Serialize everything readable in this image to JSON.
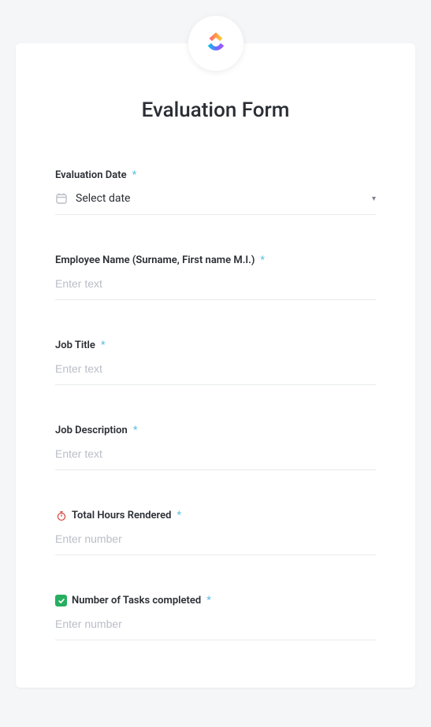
{
  "title": "Evaluation Form",
  "fields": {
    "evaluation_date": {
      "label": "Evaluation Date",
      "placeholder": "Select date"
    },
    "employee_name": {
      "label": "Employee Name (Surname, First name M.I.)",
      "placeholder": "Enter text"
    },
    "job_title": {
      "label": "Job Title",
      "placeholder": "Enter text"
    },
    "job_description": {
      "label": "Job Description",
      "placeholder": "Enter text"
    },
    "total_hours": {
      "label": "Total Hours Rendered",
      "placeholder": "Enter number"
    },
    "tasks_completed": {
      "label": "Number of Tasks completed",
      "placeholder": "Enter number"
    }
  },
  "required_marker": "*"
}
